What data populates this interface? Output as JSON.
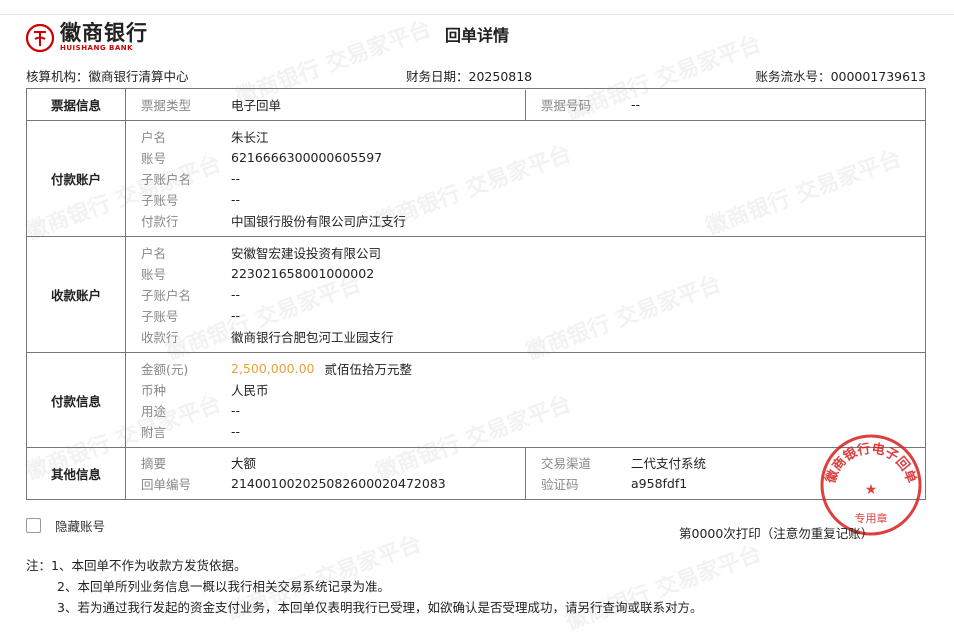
{
  "header": {
    "bank_name": "徽商银行",
    "bank_name_en": "HUISHANG BANK",
    "title": "回单详情",
    "org_label": "核算机构：",
    "org_value": "徽商银行清算中心",
    "date_label": "财务日期：",
    "date_value": "20250818",
    "serial_label": "账务流水号：",
    "serial_value": "000001739613"
  },
  "sections": {
    "ticket": {
      "title": "票据信息",
      "type_label": "票据类型",
      "type_value": "电子回单",
      "no_label": "票据号码",
      "no_value": "--"
    },
    "payer": {
      "title": "付款账户",
      "rows": [
        {
          "label": "户名",
          "value": "朱长江"
        },
        {
          "label": "账号",
          "value": "6216666300000605597"
        },
        {
          "label": "子账户名",
          "value": "--"
        },
        {
          "label": "子账号",
          "value": "--"
        },
        {
          "label": "付款行",
          "value": "中国银行股份有限公司庐江支行"
        }
      ]
    },
    "payee": {
      "title": "收款账户",
      "rows": [
        {
          "label": "户名",
          "value": "安徽智宏建设投资有限公司"
        },
        {
          "label": "账号",
          "value": "223021658001000002"
        },
        {
          "label": "子账户名",
          "value": "--"
        },
        {
          "label": "子账号",
          "value": "--"
        },
        {
          "label": "收款行",
          "value": "徽商银行合肥包河工业园支行"
        }
      ]
    },
    "payment": {
      "title": "付款信息",
      "amount_label": "金额(元)",
      "amount_value": "2,500,000.00",
      "amount_words": "贰佰伍拾万元整",
      "currency_label": "币种",
      "currency_value": "人民币",
      "purpose_label": "用途",
      "purpose_value": "--",
      "remark_label": "附言",
      "remark_value": "--"
    },
    "other": {
      "title": "其他信息",
      "summary_label": "摘要",
      "summary_value": "大额",
      "receipt_no_label": "回单编号",
      "receipt_no_value": "21400100202508260002047208 3",
      "channel_label": "交易渠道",
      "channel_value": "二代支付系统",
      "verify_label": "验证码",
      "verify_value": "a958fdf1"
    }
  },
  "footer": {
    "hide_account_label": "隐藏账号",
    "print_count": "第0000次打印（注意勿重复记账）",
    "notes": [
      "注：1、本回单不作为收款方发货依据。",
      "2、本回单所列业务信息一概以我行相关交易系统记录为准。",
      "3、若为通过我行发起的资金支付业务，本回单仅表明我行已受理，如欲确认是否受理成功，请另行查询或联系对方。"
    ]
  },
  "stamp": {
    "text_top": "徽商银行电子回单",
    "text_center": "专用章"
  },
  "watermark_text": "徽商银行 交易家平台",
  "colors": {
    "brand_red": "#cc0000",
    "amount": "#e6a23c",
    "stamp_red": "#d81e1e"
  }
}
